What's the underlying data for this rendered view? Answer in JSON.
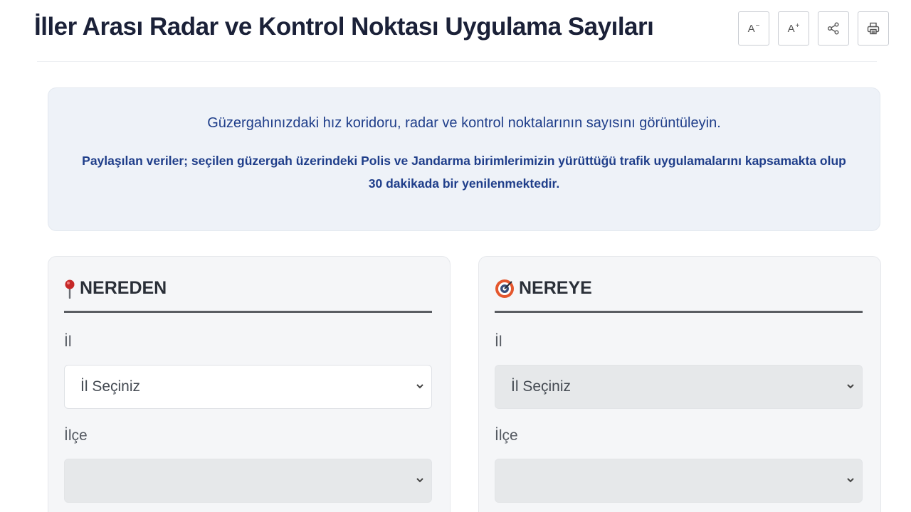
{
  "header": {
    "title": "İller Arası Radar ve Kontrol Noktası Uygulama Sayıları",
    "tools": [
      {
        "label": "A",
        "sup": "−",
        "icon": "font-decrease-icon"
      },
      {
        "label": "A",
        "sup": "+",
        "icon": "font-increase-icon"
      },
      {
        "label": "",
        "icon": "share-icon"
      },
      {
        "label": "",
        "icon": "print-icon"
      }
    ]
  },
  "info": {
    "line1": "Güzergahınızdaki hız koridoru, radar ve kontrol noktalarının sayısını görüntüleyin.",
    "line2": "Paylaşılan veriler; seçilen güzergah üzerindeki Polis ve Jandarma birimlerimizin yürüttüğü trafik uygulamalarını kapsamakta olup 30 dakikada bir yenilenmektedir."
  },
  "from": {
    "title": "NEREDEN",
    "icon": "pin-icon",
    "il_label": "İl",
    "il_value": "İl Seçiniz",
    "ilce_label": "İlçe",
    "ilce_value": ""
  },
  "to": {
    "title": "NEREYE",
    "icon": "target-icon",
    "il_label": "İl",
    "il_value": "İl Seçiniz",
    "ilce_label": "İlçe",
    "ilce_value": ""
  },
  "colors": {
    "info_text": "#1f3e8a",
    "info_bg": "#eef2f8",
    "pin": "#c62828",
    "target": "#e4572e"
  }
}
